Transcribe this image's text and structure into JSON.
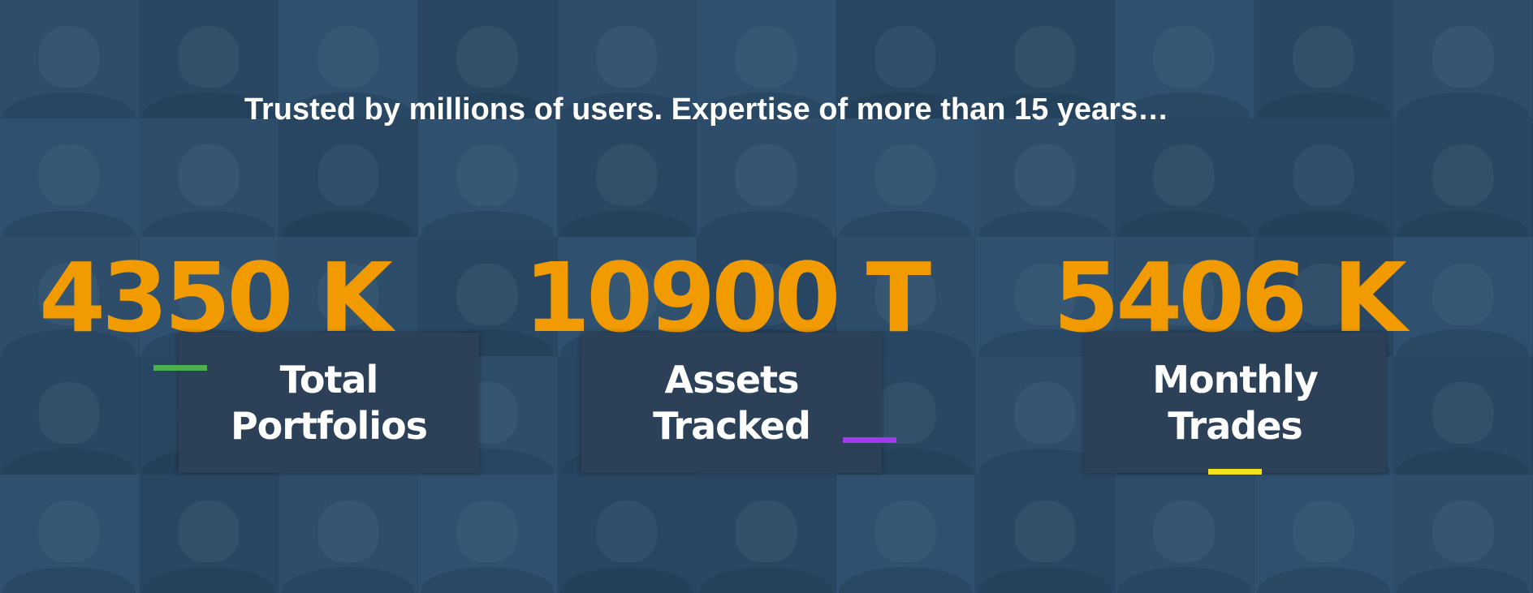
{
  "headline": "Trusted by millions of users. Expertise of more than 15 years…",
  "stats": [
    {
      "number": "4350 K",
      "label_line1": "Total",
      "label_line2": "Portfolios",
      "accent_color": "#4caf50"
    },
    {
      "number": "10900 T",
      "label_line1": "Assets",
      "label_line2": "Tracked",
      "accent_color": "#a23bf0"
    },
    {
      "number": "5406 K",
      "label_line1": "Monthly",
      "label_line2": "Trades",
      "accent_color": "#f2e01a"
    }
  ],
  "colors": {
    "background": "#2d4d69",
    "number": "#f29b00",
    "box": "#2c4158",
    "text": "#ffffff"
  },
  "background_image": "grid-of-smiling-user-faces"
}
